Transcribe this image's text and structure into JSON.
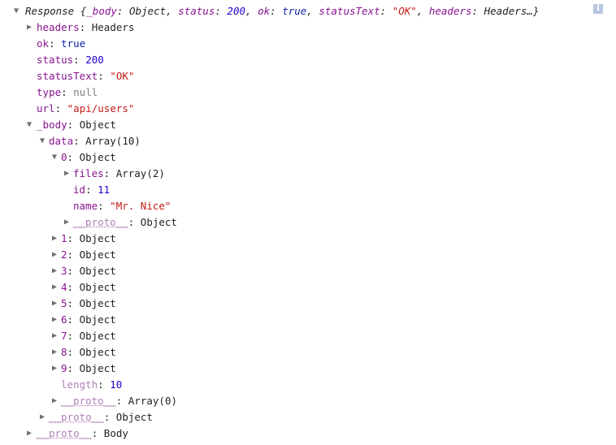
{
  "console": {
    "info_icon": "i",
    "summary": {
      "class": "Response",
      "open": "{",
      "body_key": "_body",
      "body_val": "Object",
      "status_key": "status",
      "status_val": "200",
      "ok_key": "ok",
      "ok_val": "true",
      "statusText_key": "statusText",
      "statusText_val": "\"OK\"",
      "headers_key": "headers",
      "headers_val": "Headers…",
      "close": "}"
    },
    "rows": [
      {
        "key": "headers",
        "value": "Headers"
      },
      {
        "key": "ok",
        "value": "true"
      },
      {
        "key": "status",
        "value": "200"
      },
      {
        "key": "statusText",
        "value": "\"OK\""
      },
      {
        "key": "type",
        "value": "null"
      },
      {
        "key": "url",
        "value": "\"api/users\""
      },
      {
        "key": "_body",
        "value": "Object"
      },
      {
        "key": "data",
        "value": "Array(10)"
      },
      {
        "key": "0",
        "value": "Object"
      },
      {
        "key": "files",
        "value": "Array(2)"
      },
      {
        "key": "id",
        "value": "11"
      },
      {
        "key": "name",
        "value": "\"Mr. Nice\""
      },
      {
        "key": "__proto__",
        "value": "Object"
      },
      {
        "key": "1",
        "value": "Object"
      },
      {
        "key": "2",
        "value": "Object"
      },
      {
        "key": "3",
        "value": "Object"
      },
      {
        "key": "4",
        "value": "Object"
      },
      {
        "key": "5",
        "value": "Object"
      },
      {
        "key": "6",
        "value": "Object"
      },
      {
        "key": "7",
        "value": "Object"
      },
      {
        "key": "8",
        "value": "Object"
      },
      {
        "key": "9",
        "value": "Object"
      },
      {
        "key": "length",
        "value": "10"
      },
      {
        "key": "__proto__",
        "value": "Array(0)"
      },
      {
        "key": "__proto__",
        "value": "Object"
      },
      {
        "key": "__proto__",
        "value": "Body"
      }
    ],
    "toggles": {
      "expanded": "▼",
      "collapsed": "▶"
    },
    "separator": ": ",
    "colors": {
      "key": "#881391",
      "number": "#1c00cf",
      "string": "#c41a16",
      "boolean": "#0d22aa",
      "null": "#808080",
      "proto": "#b07fb7"
    }
  }
}
